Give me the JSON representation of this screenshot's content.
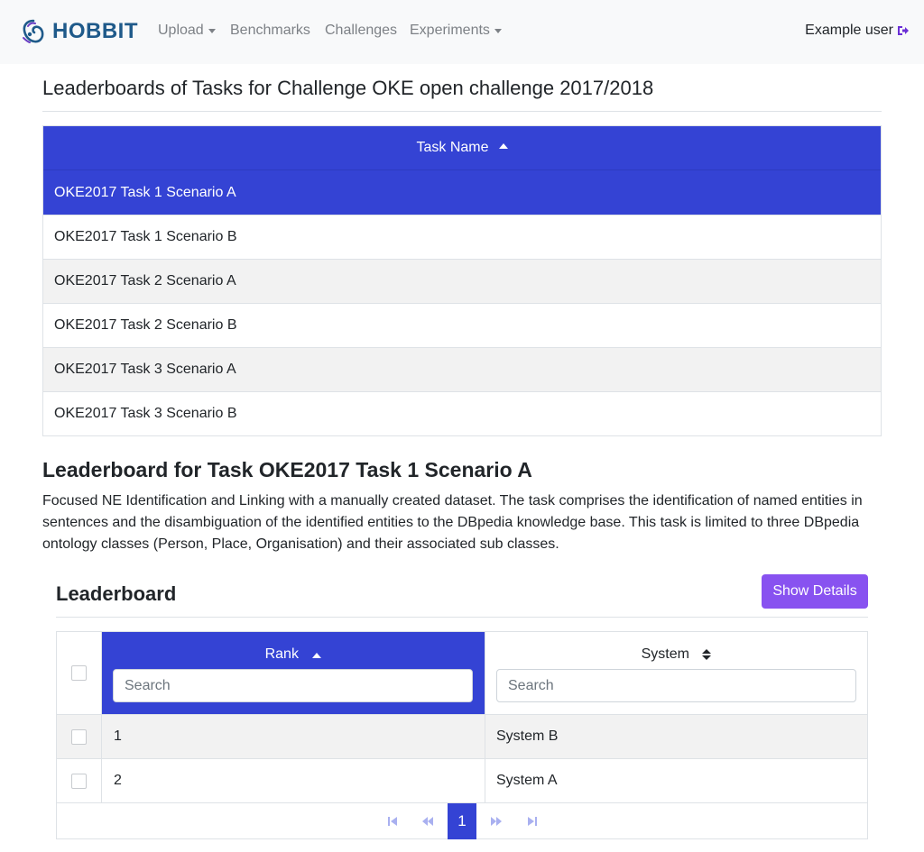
{
  "navbar": {
    "brand": "HOBBIT",
    "items": [
      {
        "label": "Upload",
        "dropdown": true
      },
      {
        "label": "Benchmarks",
        "dropdown": false
      },
      {
        "label": "Challenges",
        "dropdown": false
      },
      {
        "label": "Experiments",
        "dropdown": true
      }
    ],
    "user": "Example user"
  },
  "page_title": "Leaderboards of Tasks for Challenge OKE open challenge 2017/2018",
  "task_table": {
    "header": "Task Name",
    "rows": [
      "OKE2017 Task 1 Scenario A",
      "OKE2017 Task 1 Scenario B",
      "OKE2017 Task 2 Scenario A",
      "OKE2017 Task 2 Scenario B",
      "OKE2017 Task 3 Scenario A",
      "OKE2017 Task 3 Scenario B"
    ],
    "selected_index": 0
  },
  "leaderboard": {
    "title": "Leaderboard for Task OKE2017 Task 1 Scenario A",
    "description": "Focused NE Identification and Linking with a manually created dataset. The task comprises the identification of named entities in sentences and the disambiguation of the identified entities to the DBpedia knowledge base. This task is limited to three DBpedia ontology classes (Person, Place, Organisation) and their associated sub classes.",
    "panel_title": "Leaderboard",
    "details_button": "Show Details",
    "columns": {
      "rank": "Rank",
      "system": "System"
    },
    "search_placeholder": "Search",
    "rows": [
      {
        "rank": "1",
        "system": "System B"
      },
      {
        "rank": "2",
        "system": "System A"
      }
    ],
    "pagination": {
      "current_page": "1"
    }
  },
  "colors": {
    "primary": "#3443d4",
    "button": "#8852f0",
    "brand": "#1f5a8a"
  }
}
